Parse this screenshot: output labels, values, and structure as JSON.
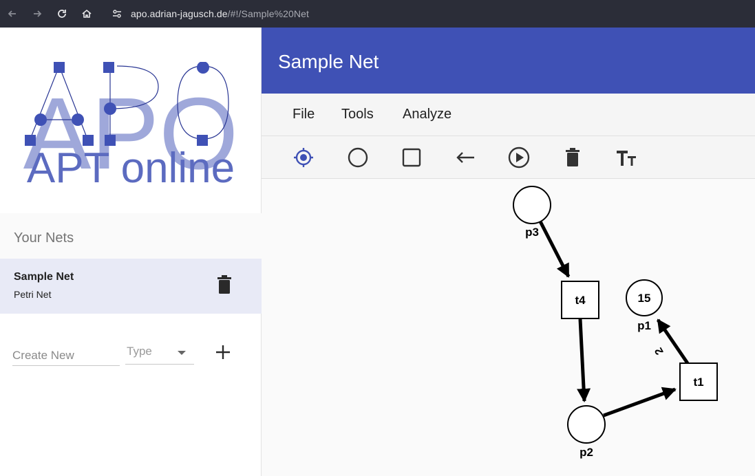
{
  "browser": {
    "url_host": "apo.adrian-jagusch.de",
    "url_path": "/#!/Sample%20Net"
  },
  "sidebar": {
    "logo_text": "APO",
    "logo_subtitle": "APT online",
    "nets_heading": "Your Nets",
    "nets": [
      {
        "name": "Sample Net",
        "type": "Petri Net"
      }
    ],
    "create": {
      "placeholder": "Create New",
      "type_placeholder": "Type"
    }
  },
  "header": {
    "title": "Sample Net"
  },
  "menu": {
    "items": [
      "File",
      "Tools",
      "Analyze"
    ]
  },
  "toolbar": {
    "tools": [
      "select-target-icon",
      "place-circle-icon",
      "transition-square-icon",
      "arc-arrow-icon",
      "play-icon",
      "delete-icon",
      "text-size-icon"
    ],
    "active_tool": "select-target-icon"
  },
  "net": {
    "places": [
      {
        "id": "p3",
        "label": "p3",
        "tokens": ""
      },
      {
        "id": "p1",
        "label": "p1",
        "tokens": "15"
      },
      {
        "id": "p2",
        "label": "p2",
        "tokens": ""
      }
    ],
    "transitions": [
      {
        "id": "t4",
        "label": "t4"
      },
      {
        "id": "t1",
        "label": "t1"
      }
    ],
    "arcs": [
      {
        "from": "p3",
        "to": "t4",
        "weight": ""
      },
      {
        "from": "t4",
        "to": "p2",
        "weight": ""
      },
      {
        "from": "p2",
        "to": "t1",
        "weight": ""
      },
      {
        "from": "t1",
        "to": "p1",
        "weight": "2"
      }
    ]
  },
  "colors": {
    "primary": "#3f51b5",
    "logo": "#5c6bc0",
    "logo_light": "#9fa8da",
    "selected_row": "#e8eaf6"
  }
}
